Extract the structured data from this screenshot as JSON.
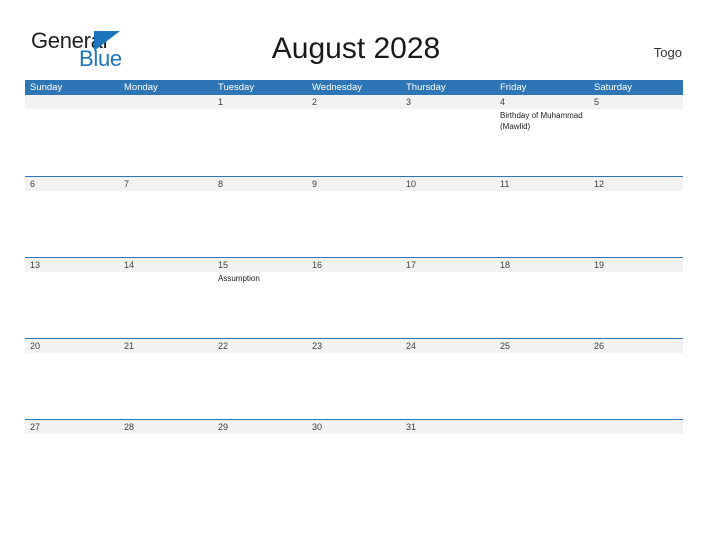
{
  "brand": {
    "name_part1": "General",
    "name_part2": "Blue"
  },
  "header": {
    "title": "August 2028",
    "country": "Togo"
  },
  "calendar": {
    "weekday_headers": [
      "Sunday",
      "Monday",
      "Tuesday",
      "Wednesday",
      "Thursday",
      "Friday",
      "Saturday"
    ],
    "colors": {
      "header_blue": "#2e75b6",
      "band_gray": "#f2f2f2",
      "brand_blue": "#1b75bb",
      "text_dark": "#231f20"
    },
    "weeks": [
      {
        "days": [
          {
            "date": "",
            "events": []
          },
          {
            "date": "",
            "events": []
          },
          {
            "date": "1",
            "events": []
          },
          {
            "date": "2",
            "events": []
          },
          {
            "date": "3",
            "events": []
          },
          {
            "date": "4",
            "events": [
              "Birthday of Muhammad (Mawlid)"
            ]
          },
          {
            "date": "5",
            "events": []
          }
        ]
      },
      {
        "days": [
          {
            "date": "6",
            "events": []
          },
          {
            "date": "7",
            "events": []
          },
          {
            "date": "8",
            "events": []
          },
          {
            "date": "9",
            "events": []
          },
          {
            "date": "10",
            "events": []
          },
          {
            "date": "11",
            "events": []
          },
          {
            "date": "12",
            "events": []
          }
        ]
      },
      {
        "days": [
          {
            "date": "13",
            "events": []
          },
          {
            "date": "14",
            "events": []
          },
          {
            "date": "15",
            "events": [
              "Assumption"
            ]
          },
          {
            "date": "16",
            "events": []
          },
          {
            "date": "17",
            "events": []
          },
          {
            "date": "18",
            "events": []
          },
          {
            "date": "19",
            "events": []
          }
        ]
      },
      {
        "days": [
          {
            "date": "20",
            "events": []
          },
          {
            "date": "21",
            "events": []
          },
          {
            "date": "22",
            "events": []
          },
          {
            "date": "23",
            "events": []
          },
          {
            "date": "24",
            "events": []
          },
          {
            "date": "25",
            "events": []
          },
          {
            "date": "26",
            "events": []
          }
        ]
      },
      {
        "days": [
          {
            "date": "27",
            "events": []
          },
          {
            "date": "28",
            "events": []
          },
          {
            "date": "29",
            "events": []
          },
          {
            "date": "30",
            "events": []
          },
          {
            "date": "31",
            "events": []
          },
          {
            "date": "",
            "events": []
          },
          {
            "date": "",
            "events": []
          }
        ]
      }
    ]
  }
}
